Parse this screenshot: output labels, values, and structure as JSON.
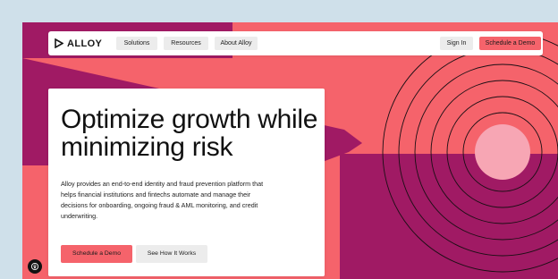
{
  "nav": {
    "logo_text": "ALLOY",
    "items": [
      {
        "label": "Solutions"
      },
      {
        "label": "Resources"
      },
      {
        "label": "About Alloy"
      }
    ],
    "sign_in": "Sign In",
    "cta": "Schedule a Demo"
  },
  "hero": {
    "headline_line1": "Optimize growth while",
    "headline_line2": "minimizing risk",
    "description": "Alloy provides an end-to-end identity and fraud prevention platform that helps financial institutions and fintechs automate and manage their decisions for onboarding, ongoing fraud & AML monitoring, and credit underwriting.",
    "primary_button": "Schedule a Demo",
    "secondary_button": "See How It Works"
  },
  "colors": {
    "coral": "#f5636b",
    "magenta": "#a01a64",
    "pink": "#f7a6b4",
    "page_bg": "#cfe0ea"
  },
  "icons": {
    "accessibility_badge": "accessibility-icon"
  }
}
